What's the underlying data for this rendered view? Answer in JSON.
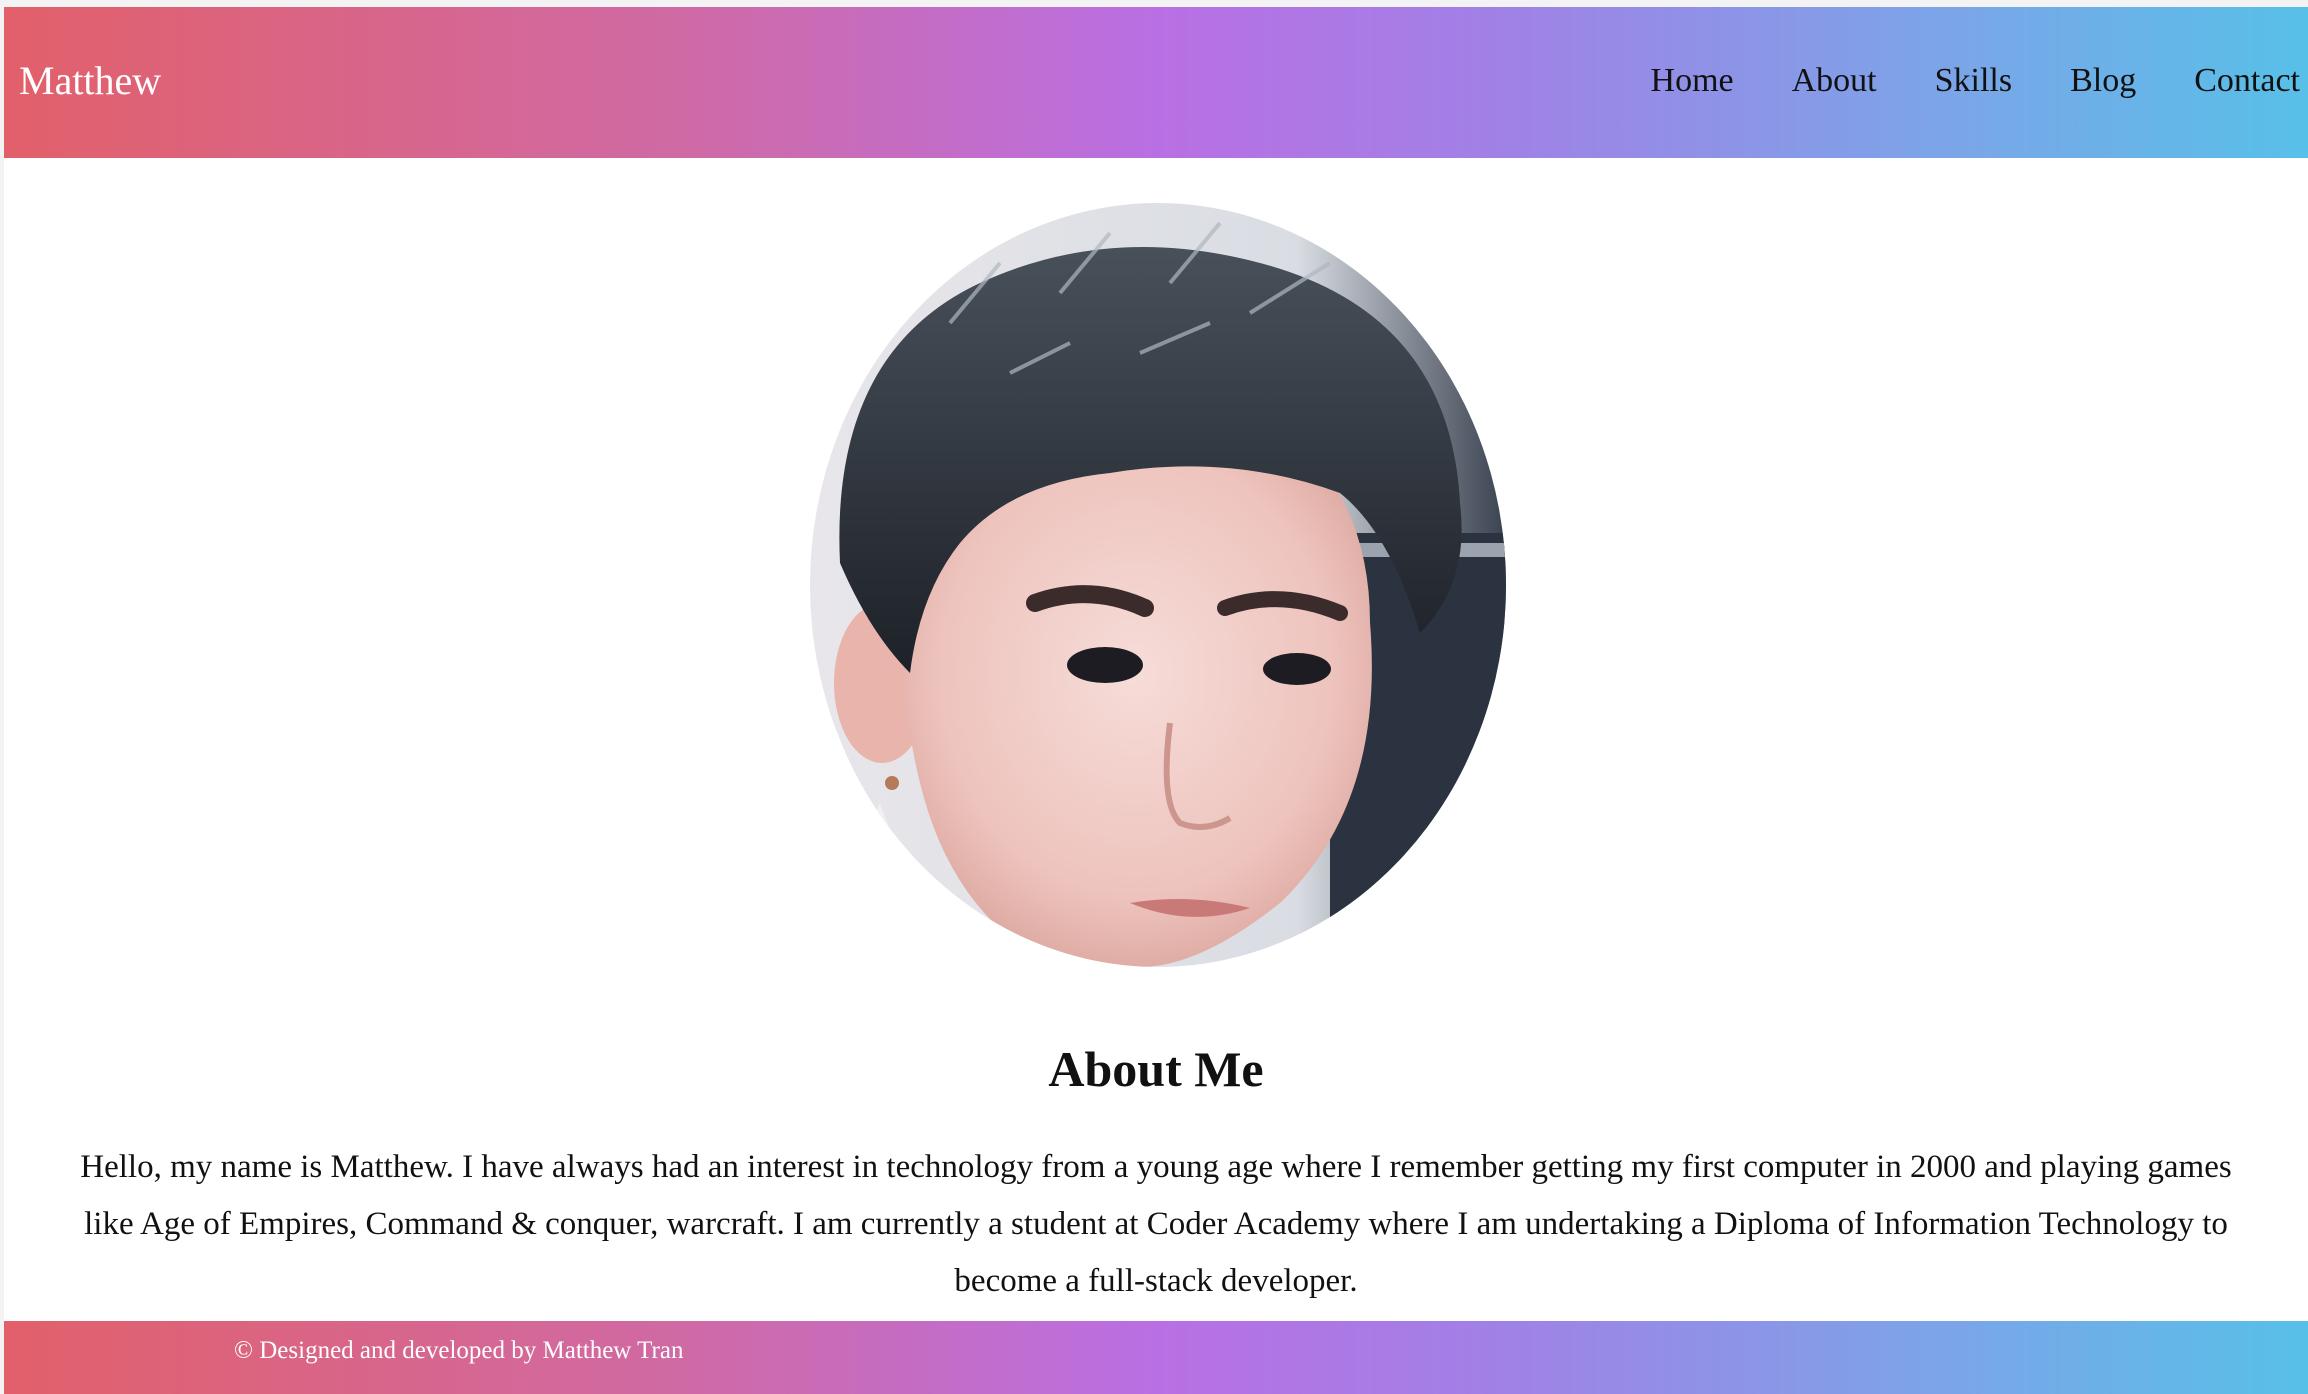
{
  "header": {
    "brand": "Matthew",
    "nav": [
      {
        "label": "Home"
      },
      {
        "label": "About"
      },
      {
        "label": "Skills"
      },
      {
        "label": "Blog"
      },
      {
        "label": "Contact"
      }
    ]
  },
  "profile": {
    "photo_icon": "profile-photo"
  },
  "about": {
    "heading": "About Me",
    "bio": "Hello, my name is Matthew. I have always had an interest in technology from a young age where I remember getting my first computer in 2000 and playing games like Age of Empires, Command & conquer, warcraft. I am currently a student at Coder Academy where I am undertaking a Diploma of Information Technology to become a full-stack developer."
  },
  "footer": {
    "text": "© Designed and developed by Matthew Tran"
  },
  "colors": {
    "gradient_start": "#e2606a",
    "gradient_mid": "#b96fe3",
    "gradient_end": "#57c0e8"
  }
}
